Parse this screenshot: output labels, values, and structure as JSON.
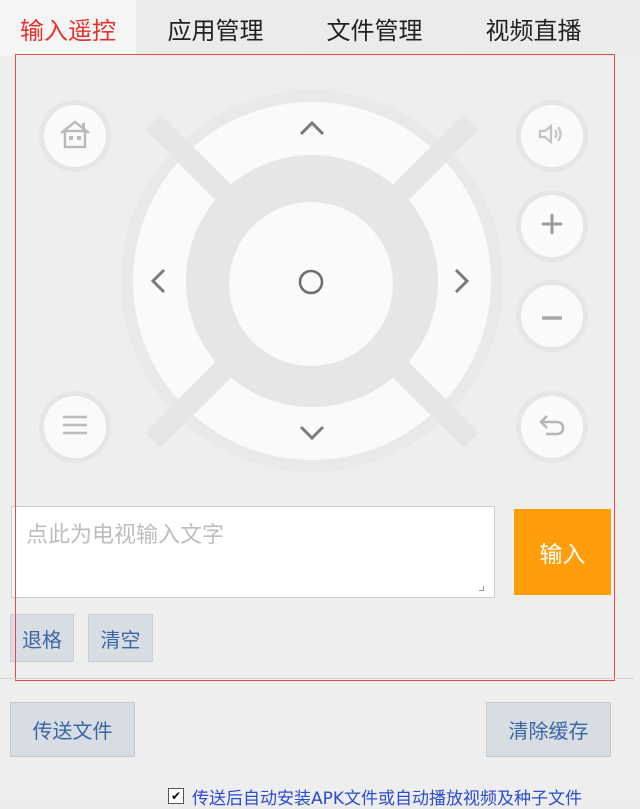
{
  "tabs": [
    {
      "label": "输入遥控",
      "active": true
    },
    {
      "label": "应用管理",
      "active": false
    },
    {
      "label": "文件管理",
      "active": false
    },
    {
      "label": "视频直播",
      "active": false
    }
  ],
  "remote": {
    "center_symbol": "○",
    "home_icon": "home-icon",
    "menu_icon": "menu-icon",
    "volume_icon": "speaker-icon",
    "back_icon": "back-arrow-icon"
  },
  "text_input": {
    "placeholder": "点此为电视输入文字",
    "value": ""
  },
  "buttons": {
    "enter": "输入",
    "backspace": "退格",
    "clear": "清空",
    "send_file": "传送文件",
    "clear_cache": "清除缓存"
  },
  "auto_install": {
    "checked": true,
    "label": "传送后自动安装APK文件或自动播放视频及种子文件"
  },
  "colors": {
    "active_tab": "#e8322e",
    "enter_button": "#ff9d0a",
    "link_text": "#3a66a6",
    "checkbox_label": "#2a4ccf"
  }
}
